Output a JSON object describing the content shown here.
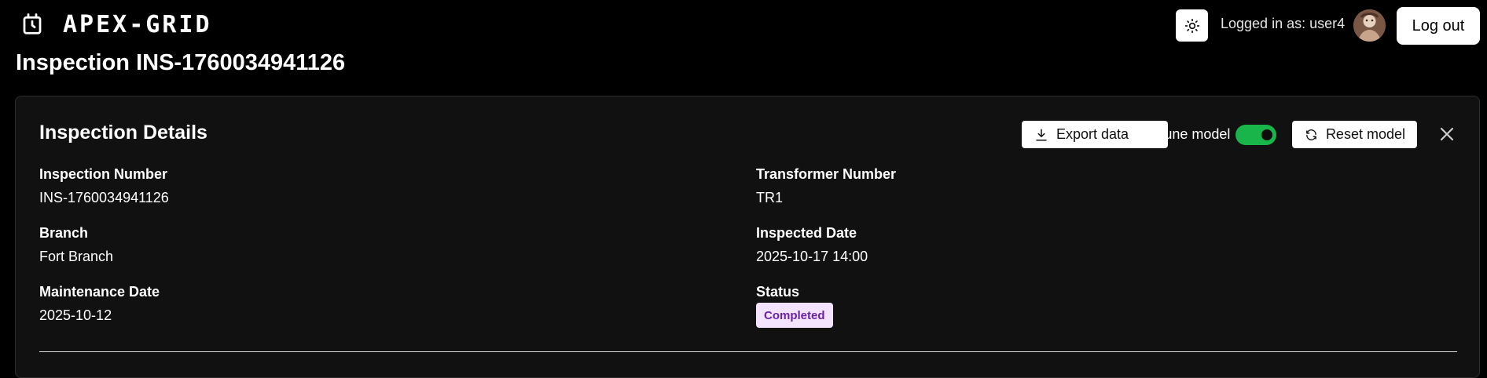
{
  "app": {
    "brand": "APEX-GRID",
    "logged_in_text": "Logged in as: user4",
    "logout_label": "Log out",
    "brand_icon": "battery-clock-icon",
    "theme_icon": "sun-icon"
  },
  "page": {
    "title": "Inspection INS-1760034941126"
  },
  "card": {
    "title": "Inspection Details",
    "export_label": "Export data",
    "tune_label": "Tune model",
    "tune_enabled": true,
    "reset_label": "Reset model",
    "close_icon": "close-icon"
  },
  "details": {
    "inspection_number_label": "Inspection Number",
    "inspection_number": "INS-1760034941126",
    "transformer_number_label": "Transformer Number",
    "transformer_number": "TR1",
    "branch_label": "Branch",
    "branch": "Fort Branch",
    "inspected_date_label": "Inspected Date",
    "inspected_date": "2025-10-17 14:00",
    "maintenance_date_label": "Maintenance Date",
    "maintenance_date": "2025-10-12",
    "status_label": "Status",
    "status": "Completed"
  },
  "colors": {
    "background": "#000000",
    "card": "#111111",
    "toggle_on": "#19b54a",
    "status_badge_bg": "#f4e3ff",
    "status_badge_text": "#6b21a8"
  }
}
